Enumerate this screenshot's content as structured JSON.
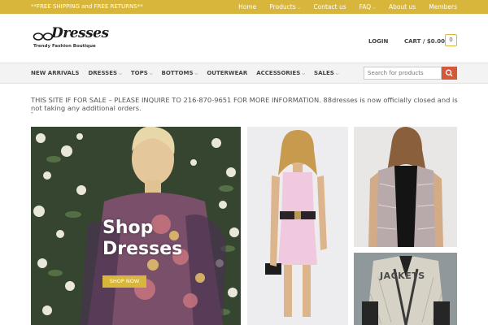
{
  "topbar": {
    "promo": "**FREE SHIPPING and FREE RETURNS**",
    "links": [
      "Home",
      "Products",
      "Contact us",
      "FAQ",
      "About us",
      "Members"
    ]
  },
  "header": {
    "logo_text": "Dresses",
    "logo_tagline": "Trendy Fashion Boutique",
    "login": "LOGIN",
    "cart": "CART / $0.00",
    "cart_count": "0"
  },
  "nav": {
    "items": [
      "NEW ARRIVALS",
      "DRESSES",
      "TOPS",
      "BOTTOMS",
      "OUTERWEAR",
      "ACCESSORIES",
      "SALES"
    ],
    "search_placeholder": "Search for products"
  },
  "notice": {
    "text": "THIS SITE IF FOR SALE – PLEASE INQUIRE TO 216-870-9651 FOR MORE INFORMATION. 88dresses is now officially closed and is not taking any additional orders.",
    "dash": "-"
  },
  "tiles": {
    "main_title_1": "Shop",
    "main_title_2": "Dresses",
    "main_button": "SHOP NOW",
    "jackets_label": "JACKETS"
  },
  "colors": {
    "accent": "#d8b63c",
    "search_button": "#d4583a"
  }
}
